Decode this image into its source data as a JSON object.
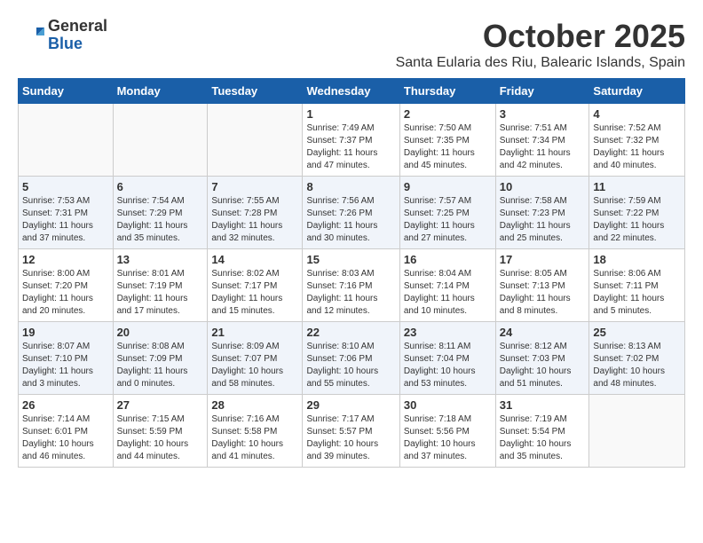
{
  "header": {
    "logo_general": "General",
    "logo_blue": "Blue",
    "month": "October 2025",
    "location": "Santa Eularia des Riu, Balearic Islands, Spain"
  },
  "weekdays": [
    "Sunday",
    "Monday",
    "Tuesday",
    "Wednesday",
    "Thursday",
    "Friday",
    "Saturday"
  ],
  "weeks": [
    [
      {
        "day": "",
        "info": ""
      },
      {
        "day": "",
        "info": ""
      },
      {
        "day": "",
        "info": ""
      },
      {
        "day": "1",
        "info": "Sunrise: 7:49 AM\nSunset: 7:37 PM\nDaylight: 11 hours\nand 47 minutes."
      },
      {
        "day": "2",
        "info": "Sunrise: 7:50 AM\nSunset: 7:35 PM\nDaylight: 11 hours\nand 45 minutes."
      },
      {
        "day": "3",
        "info": "Sunrise: 7:51 AM\nSunset: 7:34 PM\nDaylight: 11 hours\nand 42 minutes."
      },
      {
        "day": "4",
        "info": "Sunrise: 7:52 AM\nSunset: 7:32 PM\nDaylight: 11 hours\nand 40 minutes."
      }
    ],
    [
      {
        "day": "5",
        "info": "Sunrise: 7:53 AM\nSunset: 7:31 PM\nDaylight: 11 hours\nand 37 minutes."
      },
      {
        "day": "6",
        "info": "Sunrise: 7:54 AM\nSunset: 7:29 PM\nDaylight: 11 hours\nand 35 minutes."
      },
      {
        "day": "7",
        "info": "Sunrise: 7:55 AM\nSunset: 7:28 PM\nDaylight: 11 hours\nand 32 minutes."
      },
      {
        "day": "8",
        "info": "Sunrise: 7:56 AM\nSunset: 7:26 PM\nDaylight: 11 hours\nand 30 minutes."
      },
      {
        "day": "9",
        "info": "Sunrise: 7:57 AM\nSunset: 7:25 PM\nDaylight: 11 hours\nand 27 minutes."
      },
      {
        "day": "10",
        "info": "Sunrise: 7:58 AM\nSunset: 7:23 PM\nDaylight: 11 hours\nand 25 minutes."
      },
      {
        "day": "11",
        "info": "Sunrise: 7:59 AM\nSunset: 7:22 PM\nDaylight: 11 hours\nand 22 minutes."
      }
    ],
    [
      {
        "day": "12",
        "info": "Sunrise: 8:00 AM\nSunset: 7:20 PM\nDaylight: 11 hours\nand 20 minutes."
      },
      {
        "day": "13",
        "info": "Sunrise: 8:01 AM\nSunset: 7:19 PM\nDaylight: 11 hours\nand 17 minutes."
      },
      {
        "day": "14",
        "info": "Sunrise: 8:02 AM\nSunset: 7:17 PM\nDaylight: 11 hours\nand 15 minutes."
      },
      {
        "day": "15",
        "info": "Sunrise: 8:03 AM\nSunset: 7:16 PM\nDaylight: 11 hours\nand 12 minutes."
      },
      {
        "day": "16",
        "info": "Sunrise: 8:04 AM\nSunset: 7:14 PM\nDaylight: 11 hours\nand 10 minutes."
      },
      {
        "day": "17",
        "info": "Sunrise: 8:05 AM\nSunset: 7:13 PM\nDaylight: 11 hours\nand 8 minutes."
      },
      {
        "day": "18",
        "info": "Sunrise: 8:06 AM\nSunset: 7:11 PM\nDaylight: 11 hours\nand 5 minutes."
      }
    ],
    [
      {
        "day": "19",
        "info": "Sunrise: 8:07 AM\nSunset: 7:10 PM\nDaylight: 11 hours\nand 3 minutes."
      },
      {
        "day": "20",
        "info": "Sunrise: 8:08 AM\nSunset: 7:09 PM\nDaylight: 11 hours\nand 0 minutes."
      },
      {
        "day": "21",
        "info": "Sunrise: 8:09 AM\nSunset: 7:07 PM\nDaylight: 10 hours\nand 58 minutes."
      },
      {
        "day": "22",
        "info": "Sunrise: 8:10 AM\nSunset: 7:06 PM\nDaylight: 10 hours\nand 55 minutes."
      },
      {
        "day": "23",
        "info": "Sunrise: 8:11 AM\nSunset: 7:04 PM\nDaylight: 10 hours\nand 53 minutes."
      },
      {
        "day": "24",
        "info": "Sunrise: 8:12 AM\nSunset: 7:03 PM\nDaylight: 10 hours\nand 51 minutes."
      },
      {
        "day": "25",
        "info": "Sunrise: 8:13 AM\nSunset: 7:02 PM\nDaylight: 10 hours\nand 48 minutes."
      }
    ],
    [
      {
        "day": "26",
        "info": "Sunrise: 7:14 AM\nSunset: 6:01 PM\nDaylight: 10 hours\nand 46 minutes."
      },
      {
        "day": "27",
        "info": "Sunrise: 7:15 AM\nSunset: 5:59 PM\nDaylight: 10 hours\nand 44 minutes."
      },
      {
        "day": "28",
        "info": "Sunrise: 7:16 AM\nSunset: 5:58 PM\nDaylight: 10 hours\nand 41 minutes."
      },
      {
        "day": "29",
        "info": "Sunrise: 7:17 AM\nSunset: 5:57 PM\nDaylight: 10 hours\nand 39 minutes."
      },
      {
        "day": "30",
        "info": "Sunrise: 7:18 AM\nSunset: 5:56 PM\nDaylight: 10 hours\nand 37 minutes."
      },
      {
        "day": "31",
        "info": "Sunrise: 7:19 AM\nSunset: 5:54 PM\nDaylight: 10 hours\nand 35 minutes."
      },
      {
        "day": "",
        "info": ""
      }
    ]
  ]
}
